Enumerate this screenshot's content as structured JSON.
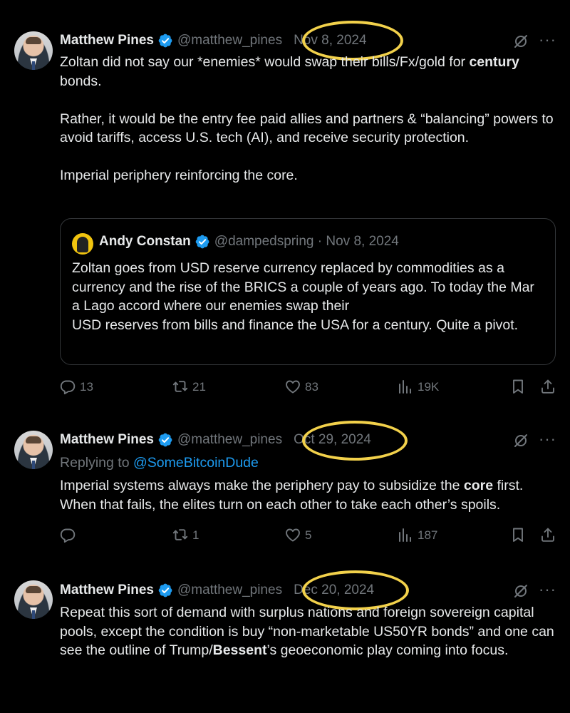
{
  "tweets": [
    {
      "name": "Matthew Pines",
      "handle": "@matthew_pines",
      "date": "Nov 8, 2024",
      "paragraphs": [
        [
          {
            "t": "Zoltan did not say our *enemies* would swap their bills/Fx/gold for "
          },
          {
            "t": "century",
            "b": true
          },
          {
            "t": " bonds."
          }
        ],
        [
          {
            "t": "Rather, it would be the entry fee paid allies and partners & “balancing” powers to avoid tariffs, access U.S. tech (AI), and receive security protection."
          }
        ],
        [
          {
            "t": "Imperial periphery reinforcing the core."
          }
        ]
      ],
      "quote": {
        "name": "Andy Constan",
        "handle": "@dampedspring",
        "date": "Nov 8, 2024",
        "lines": [
          "Zoltan goes from USD reserve currency replaced by commodities as a currency and the rise of the BRICS a couple of years ago. To today the Mar a Lago accord where our enemies swap their",
          "USD reserves from bills and finance the USA for a century.  Quite a pivot."
        ]
      },
      "replies": "13",
      "reposts": "21",
      "likes": "83",
      "views": "19K"
    },
    {
      "name": "Matthew Pines",
      "handle": "@matthew_pines",
      "date": "Oct 29, 2024",
      "replying_prefix": "Replying to ",
      "replying_to": "@SomeBitcoinDude",
      "paragraphs": [
        [
          {
            "t": "Imperial systems always make the periphery pay to subsidize the "
          },
          {
            "t": "core",
            "b": true
          },
          {
            "t": " first. When that fails, the elites turn on each other to take each other’s spoils."
          }
        ]
      ],
      "replies": "",
      "reposts": "1",
      "likes": "5",
      "views": "187"
    },
    {
      "name": "Matthew Pines",
      "handle": "@matthew_pines",
      "date": "Dec 20, 2024",
      "paragraphs": [
        [
          {
            "t": "Repeat this sort of demand with surplus nations and foreign sovereign capital pools, except the condition is buy “non-marketable US50YR bonds” and one can see the outline of Trump/"
          },
          {
            "t": "Bessent",
            "b": true
          },
          {
            "t": "’s geoeconomic play coming into focus."
          }
        ]
      ]
    }
  ],
  "colors": {
    "background": "#000000",
    "text": "#e7e9ea",
    "muted": "#71767b",
    "link": "#1d9bf0",
    "verified": "#1d9bf0",
    "highlight_ring": "#f2d14b"
  },
  "icons": [
    "verified-badge-icon",
    "grok-icon",
    "more-icon",
    "reply-icon",
    "repost-icon",
    "like-icon",
    "views-icon",
    "bookmark-icon",
    "share-icon"
  ]
}
